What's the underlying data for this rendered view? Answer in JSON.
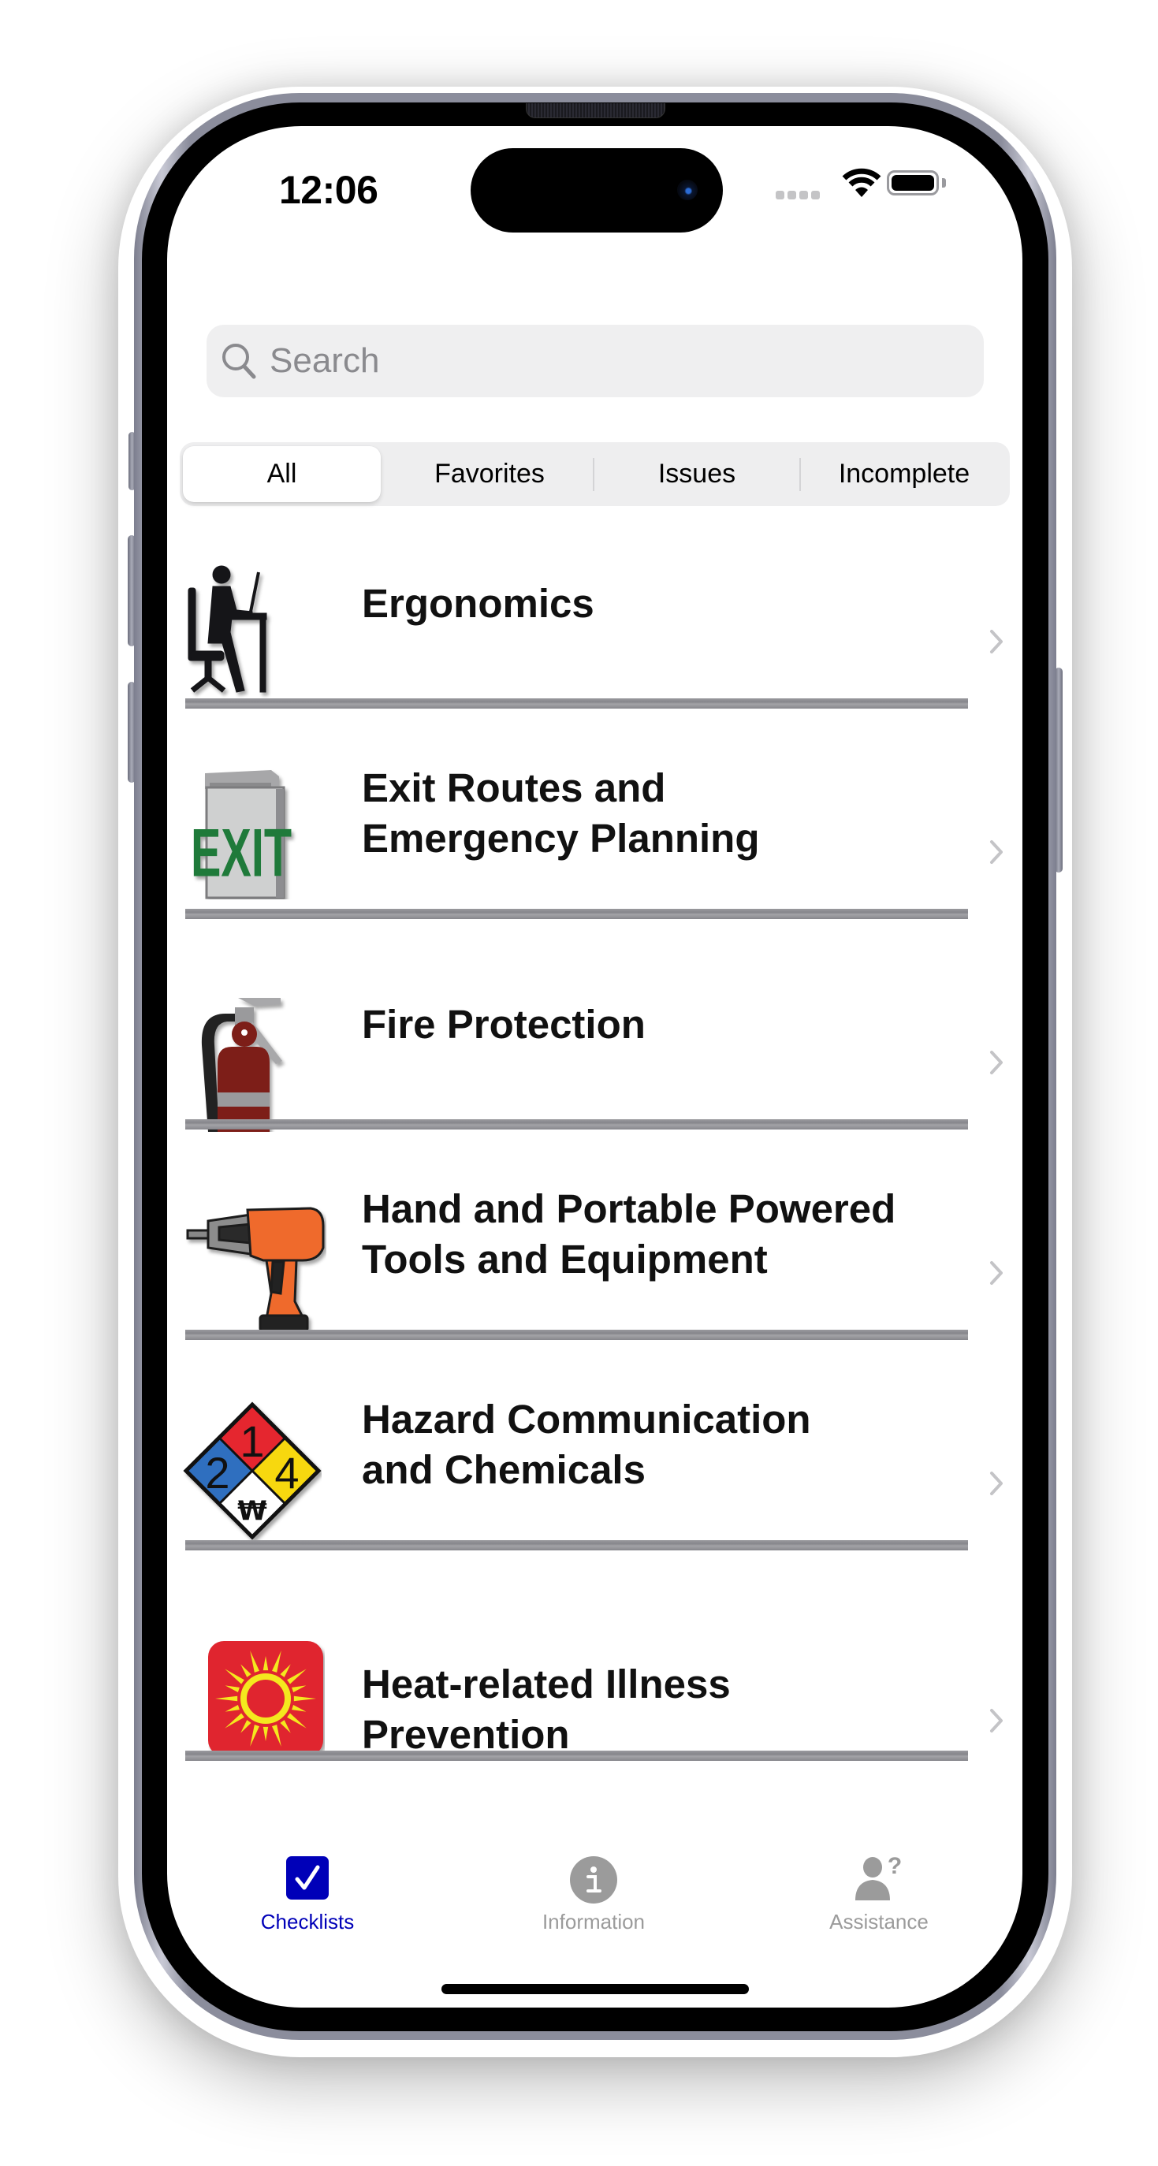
{
  "status_bar": {
    "time": "12:06",
    "signal_icon": "signal-dots-icon",
    "wifi_icon": "wifi-icon",
    "battery_icon": "battery-full-icon"
  },
  "search": {
    "placeholder": "Search",
    "value": "",
    "icon": "magnifying-glass-icon"
  },
  "filter_segments": {
    "selected": "All",
    "items": [
      {
        "label": "All"
      },
      {
        "label": "Favorites"
      },
      {
        "label": "Issues"
      },
      {
        "label": "Incomplete"
      }
    ]
  },
  "checklists": [
    {
      "title": "Ergonomics",
      "icon": "person-at-desk-icon"
    },
    {
      "title": "Exit Routes and\nEmergency Planning",
      "icon": "exit-sign-icon"
    },
    {
      "title": "Fire Protection",
      "icon": "fire-extinguisher-icon"
    },
    {
      "title": "Hand and Portable Powered\nTools and Equipment",
      "icon": "power-drill-icon"
    },
    {
      "title": "Hazard Communication\nand Chemicals",
      "icon": "nfpa-diamond-icon",
      "nfpa": {
        "health": "2",
        "flammability": "1",
        "instability": "4",
        "special": "₩"
      }
    },
    {
      "title": "Heat-related Illness Prevention",
      "icon": "sun-icon"
    }
  ],
  "tab_bar": {
    "active": "Checklists",
    "active_color": "#0000b8",
    "inactive_color": "#9b9b9b",
    "tabs": [
      {
        "label": "Checklists",
        "icon": "checkbox-icon"
      },
      {
        "label": "Information",
        "icon": "info-circle-icon"
      },
      {
        "label": "Assistance",
        "icon": "person-question-icon"
      }
    ]
  }
}
